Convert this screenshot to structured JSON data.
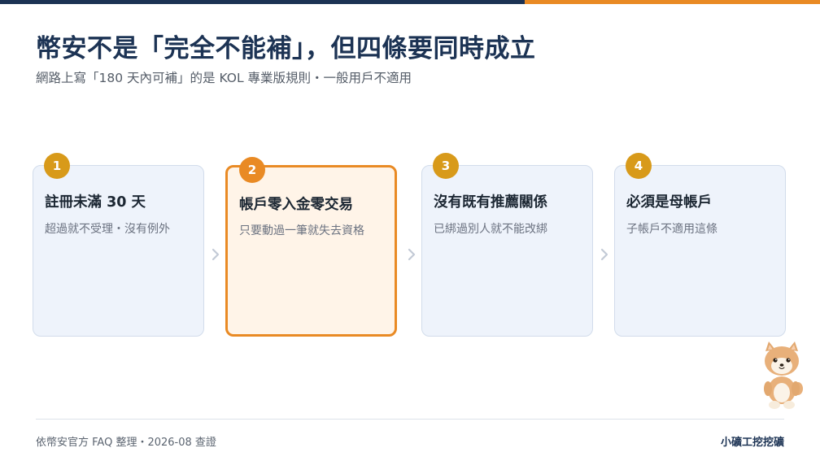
{
  "header": {
    "title": "幣安不是「完全不能補」，但四條要同時成立",
    "subtitle": "網路上寫「180 天內可補」的是 KOL 專業版規則・一般用戶不適用"
  },
  "steps": [
    {
      "number": "1",
      "title": "註冊未滿 30 天",
      "desc": "超過就不受理・沒有例外"
    },
    {
      "number": "2",
      "title": "帳戶零入金零交易",
      "desc": "只要動過一筆就失去資格"
    },
    {
      "number": "3",
      "title": "沒有既有推薦關係",
      "desc": "已綁過別人就不能改綁"
    },
    {
      "number": "4",
      "title": "必須是母帳戶",
      "desc": "子帳戶不適用這條"
    }
  ],
  "footer": {
    "source": "依幣安官方 FAQ 整理・2026-08 查證",
    "brand": "小礦工挖挖礦"
  },
  "colors": {
    "navy": "#1c3354",
    "accent": "#e98a24",
    "badge": "#d89a1a",
    "card_bg": "#eef3fb",
    "active_bg": "#fff4e8"
  },
  "icons": {
    "chevron": "chevron-right-icon",
    "mascot": "shiba-mascot"
  }
}
